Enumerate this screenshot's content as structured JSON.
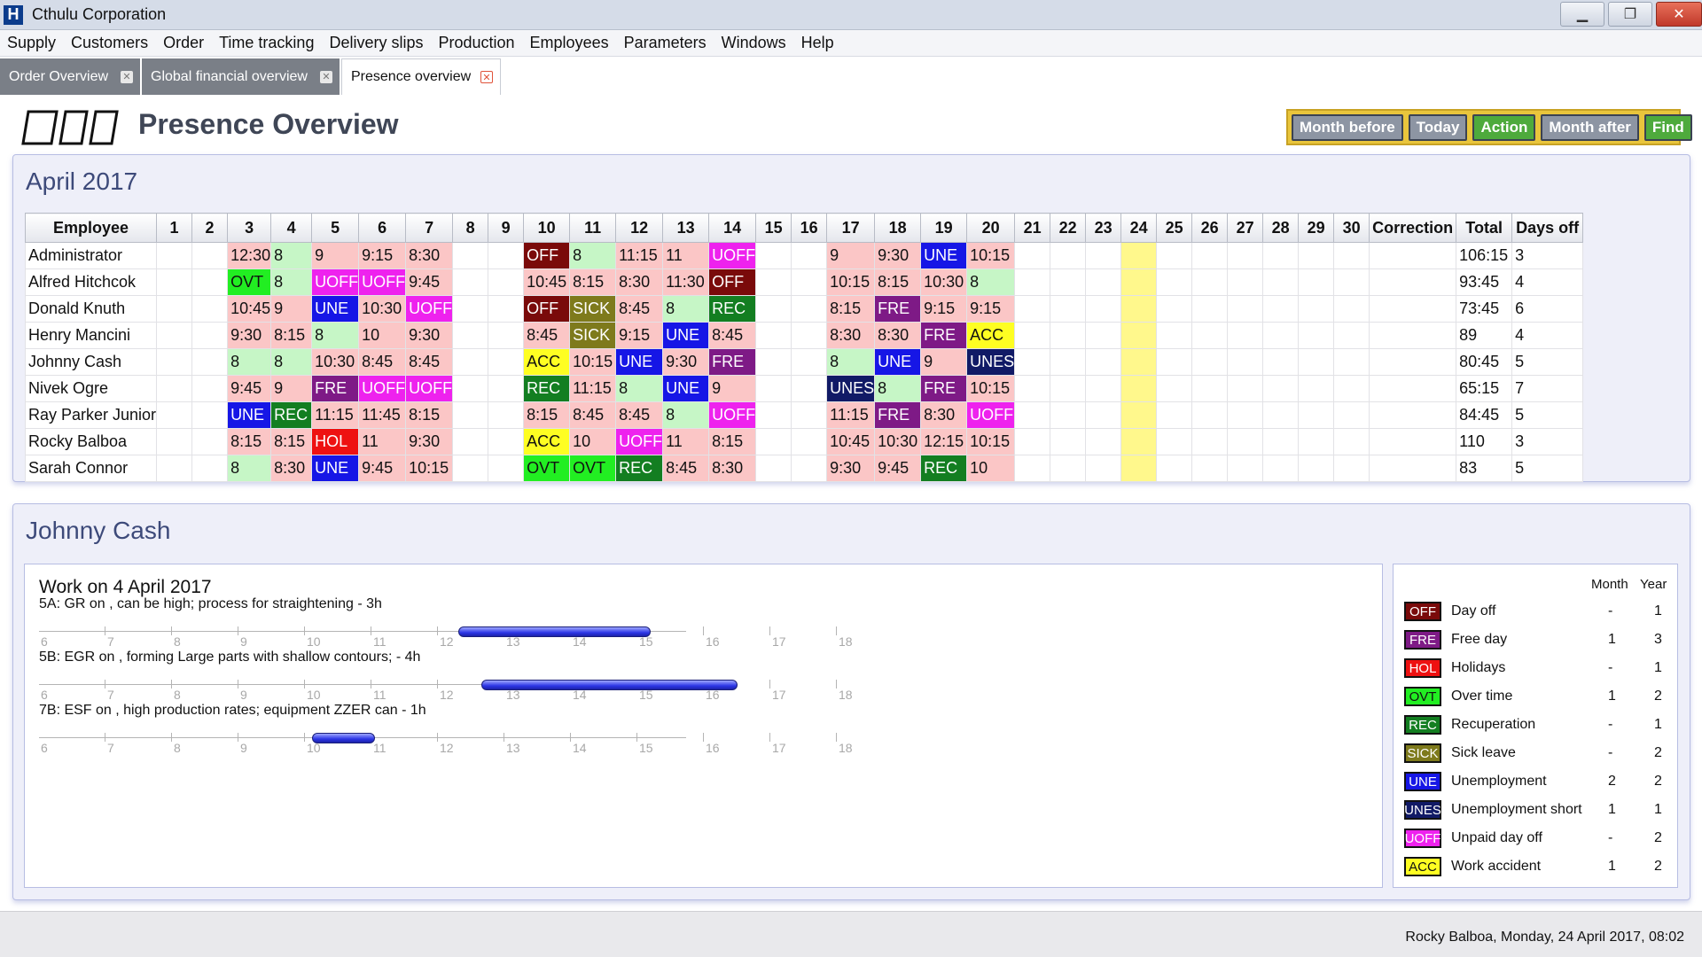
{
  "window": {
    "logo": "H",
    "title": "Cthulu Corporation",
    "controls": {
      "minimize": "▁",
      "restore": "❐",
      "close": "✕"
    }
  },
  "menu": [
    "Supply",
    "Customers",
    "Order",
    "Time tracking",
    "Delivery slips",
    "Production",
    "Employees",
    "Parameters",
    "Windows",
    "Help"
  ],
  "tabs": [
    {
      "label": "Order Overview",
      "active": false
    },
    {
      "label": "Global financial overview",
      "active": false
    },
    {
      "label": "Presence overview",
      "active": true
    }
  ],
  "page": {
    "title": "Presence Overview"
  },
  "toolbar": {
    "month_before": "Month before",
    "today": "Today",
    "action": "Action",
    "month_after": "Month after",
    "find": "Find"
  },
  "presence": {
    "month_title": "April 2017",
    "columns": {
      "employee": "Employee",
      "correction": "Correction",
      "total": "Total",
      "days_off": "Days off"
    },
    "days": [
      "1",
      "2",
      "3",
      "4",
      "5",
      "6",
      "7",
      "8",
      "9",
      "10",
      "11",
      "12",
      "13",
      "14",
      "15",
      "16",
      "17",
      "18",
      "19",
      "20",
      "21",
      "22",
      "23",
      "24",
      "25",
      "26",
      "27",
      "28",
      "29",
      "30"
    ],
    "weekend_days": [
      "1",
      "2",
      "8",
      "9",
      "15",
      "16",
      "21",
      "22",
      "23",
      "25",
      "26",
      "27",
      "28",
      "29",
      "30"
    ],
    "today_day": "24",
    "rows": [
      {
        "name": "Administrator",
        "cells": {
          "3": "12:30",
          "4": "8",
          "5": "9",
          "6": "9:15",
          "7": "8:30",
          "10": "OFF",
          "11": "8",
          "12": "11:15",
          "13": "11",
          "14": "UOFF",
          "17": "9",
          "18": "9:30",
          "19": "UNE",
          "20": "10:15"
        },
        "correction": "",
        "total": "106:15",
        "days_off": "3"
      },
      {
        "name": "Alfred Hitchcok",
        "cells": {
          "3": "OVT",
          "4": "8",
          "5": "UOFF",
          "6": "UOFF",
          "7": "9:45",
          "10": "10:45",
          "11": "8:15",
          "12": "8:30",
          "13": "11:30",
          "14": "OFF",
          "17": "10:15",
          "18": "8:15",
          "19": "10:30",
          "20": "8"
        },
        "correction": "",
        "total": "93:45",
        "days_off": "4"
      },
      {
        "name": "Donald Knuth",
        "cells": {
          "3": "10:45",
          "4": "9",
          "5": "UNE",
          "6": "10:30",
          "7": "UOFF",
          "10": "OFF",
          "11": "SICK",
          "12": "8:45",
          "13": "8",
          "14": "REC",
          "17": "8:15",
          "18": "FRE",
          "19": "9:15",
          "20": "9:15"
        },
        "correction": "",
        "total": "73:45",
        "days_off": "6"
      },
      {
        "name": "Henry Mancini",
        "cells": {
          "3": "9:30",
          "4": "8:15",
          "5": "8",
          "6": "10",
          "7": "9:30",
          "10": "8:45",
          "11": "SICK",
          "12": "9:15",
          "13": "UNE",
          "14": "8:45",
          "17": "8:30",
          "18": "8:30",
          "19": "FRE",
          "20": "ACC"
        },
        "correction": "",
        "total": "89",
        "days_off": "4"
      },
      {
        "name": "Johnny Cash",
        "cells": {
          "3": "8",
          "4": "8",
          "5": "10:30",
          "6": "8:45",
          "7": "8:45",
          "10": "ACC",
          "11": "10:15",
          "12": "UNE",
          "13": "9:30",
          "14": "FRE",
          "17": "8",
          "18": "UNE",
          "19": "9",
          "20": "UNES"
        },
        "correction": "",
        "total": "80:45",
        "days_off": "5"
      },
      {
        "name": "Nivek Ogre",
        "cells": {
          "3": "9:45",
          "4": "9",
          "5": "FRE",
          "6": "UOFF",
          "7": "UOFF",
          "10": "REC",
          "11": "11:15",
          "12": "8",
          "13": "UNE",
          "14": "9",
          "17": "UNES",
          "18": "8",
          "19": "FRE",
          "20": "10:15"
        },
        "correction": "",
        "total": "65:15",
        "days_off": "7"
      },
      {
        "name": "Ray Parker Junior",
        "cells": {
          "3": "UNE",
          "4": "REC",
          "5": "11:15",
          "6": "11:45",
          "7": "8:15",
          "10": "8:15",
          "11": "8:45",
          "12": "8:45",
          "13": "8",
          "14": "UOFF",
          "17": "11:15",
          "18": "FRE",
          "19": "8:30",
          "20": "UOFF"
        },
        "correction": "",
        "total": "84:45",
        "days_off": "5"
      },
      {
        "name": "Rocky Balboa",
        "cells": {
          "3": "8:15",
          "4": "8:15",
          "5": "HOL",
          "6": "11",
          "7": "9:30",
          "10": "ACC",
          "11": "10",
          "12": "UOFF",
          "13": "11",
          "14": "8:15",
          "17": "10:45",
          "18": "10:30",
          "19": "12:15",
          "20": "10:15"
        },
        "correction": "",
        "total": "110",
        "days_off": "3"
      },
      {
        "name": "Sarah Connor",
        "cells": {
          "3": "8",
          "4": "8:30",
          "5": "UNE",
          "6": "9:45",
          "7": "10:15",
          "10": "OVT",
          "11": "OVT",
          "12": "REC",
          "13": "8:45",
          "14": "8:30",
          "17": "9:30",
          "18": "9:45",
          "19": "REC",
          "20": "10"
        },
        "correction": "",
        "total": "83",
        "days_off": "5"
      }
    ]
  },
  "employee_panel": {
    "name": "Johnny Cash",
    "work_title": "Work on 4 April 2017",
    "axis_hours": [
      "6",
      "7",
      "8",
      "9",
      "10",
      "11",
      "12",
      "13",
      "14",
      "15",
      "16",
      "17",
      "18"
    ],
    "tasks": [
      {
        "label": "5A: GR on , can be high; process for straightening - 3h",
        "start": 12.3,
        "end": 15.2
      },
      {
        "label": "5B: EGR on , forming Large parts with shallow contours; - 4h",
        "start": 12.65,
        "end": 16.5
      },
      {
        "label": "7B: ESF on , high production rates; equipment ZZER can - 1h",
        "start": 10.1,
        "end": 11.05
      }
    ]
  },
  "legend": {
    "month_header": "Month",
    "year_header": "Year",
    "items": [
      {
        "code": "OFF",
        "label": "Day off",
        "month": "-",
        "year": "1",
        "bg": "#7a0a0a",
        "fg": "#ffffff"
      },
      {
        "code": "FRE",
        "label": "Free day",
        "month": "1",
        "year": "3",
        "bg": "#7e1a86",
        "fg": "#ffffff"
      },
      {
        "code": "HOL",
        "label": "Holidays",
        "month": "-",
        "year": "1",
        "bg": "#ee1111",
        "fg": "#ffffff"
      },
      {
        "code": "OVT",
        "label": "Over time",
        "month": "1",
        "year": "2",
        "bg": "#22ee22",
        "fg": "#111111"
      },
      {
        "code": "REC",
        "label": "Recuperation",
        "month": "-",
        "year": "1",
        "bg": "#137e21",
        "fg": "#ffffff"
      },
      {
        "code": "SICK",
        "label": "Sick leave",
        "month": "-",
        "year": "2",
        "bg": "#7e7a1c",
        "fg": "#ffffff"
      },
      {
        "code": "UNE",
        "label": "Unemployment",
        "month": "2",
        "year": "2",
        "bg": "#1616e6",
        "fg": "#ffffff"
      },
      {
        "code": "UNES",
        "label": "Unemployment short",
        "month": "1",
        "year": "1",
        "bg": "#111a66",
        "fg": "#ffffff"
      },
      {
        "code": "UOFF",
        "label": "Unpaid day off",
        "month": "-",
        "year": "2",
        "bg": "#ee22ee",
        "fg": "#ffffff"
      },
      {
        "code": "ACC",
        "label": "Work accident",
        "month": "1",
        "year": "2",
        "bg": "#fefe22",
        "fg": "#111111"
      }
    ]
  },
  "status": {
    "text": "Rocky Balboa, Monday, 24 April 2017, 08:02"
  }
}
